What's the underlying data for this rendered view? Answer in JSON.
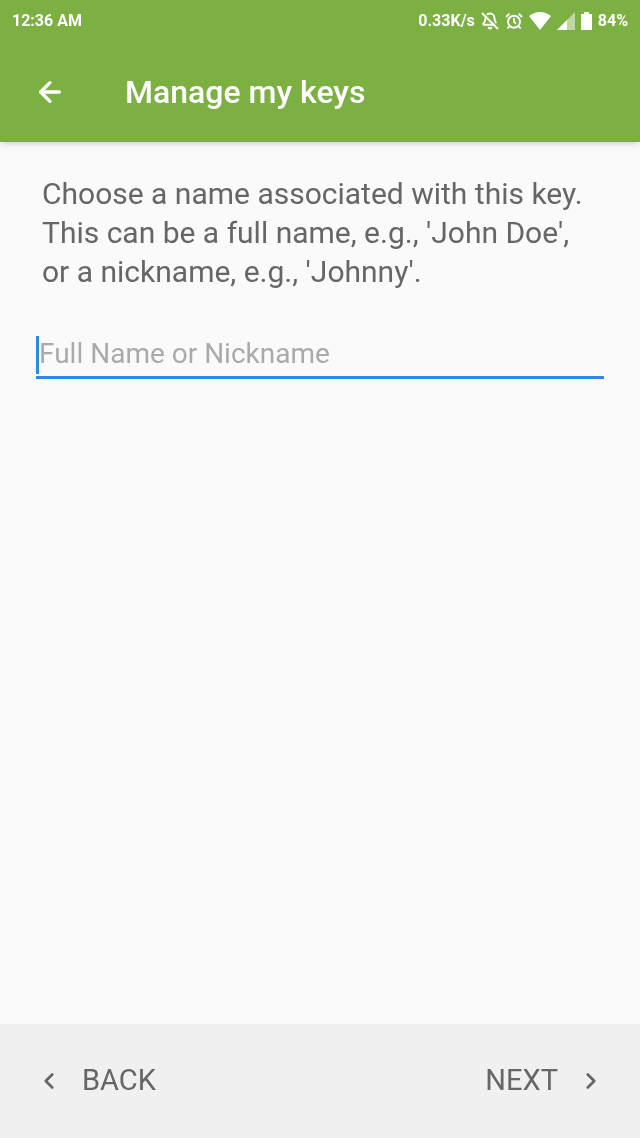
{
  "status_bar": {
    "time": "12:36 AM",
    "speed": "0.33K/s",
    "battery": "84%"
  },
  "app_bar": {
    "title": "Manage my keys"
  },
  "instructions": "Choose a name associated with this key. This can be a full name, e.g., 'John Doe', or a nickname, e.g., 'Johnny'.",
  "name_field": {
    "placeholder": "Full Name or Nickname",
    "focused": true
  },
  "footer": {
    "back": "BACK",
    "next": "NEXT"
  }
}
